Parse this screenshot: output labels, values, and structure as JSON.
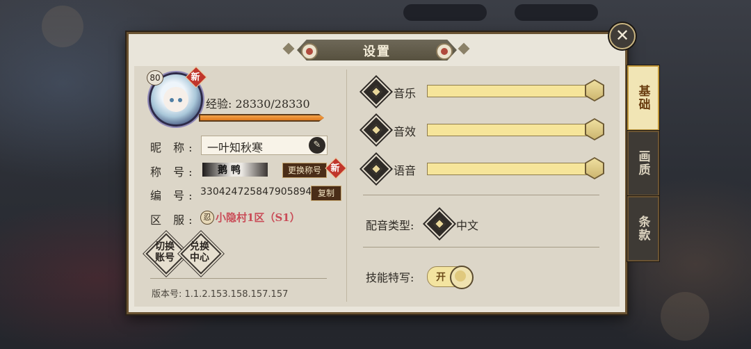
{
  "dialog": {
    "title": "设置",
    "close_symbol": "✕"
  },
  "tabs": [
    {
      "label": "基础",
      "active": true
    },
    {
      "label": "画质",
      "active": false
    },
    {
      "label": "条款",
      "active": false
    }
  ],
  "profile": {
    "level": "80",
    "new_badge": "新",
    "exp_label": "经验: 28330/28330",
    "exp_fraction": 1.0,
    "nickname_label": "昵 称:",
    "nickname_value": "一叶知秋寒",
    "title_label": "称 号:",
    "title_plate_text": "鹅 鸭",
    "change_title_button": "更换称号",
    "id_label": "编 号:",
    "id_value": "3304247258479058944",
    "copy_button": "复制",
    "server_label": "区 服:",
    "server_icon_glyph": "忍",
    "server_value": "小隐村1区（S1）",
    "switch_account_button": "切换\n账号",
    "redeem_center_button": "兑换\n中心",
    "version": "版本号: 1.1.2.153.158.157.157"
  },
  "audio": [
    {
      "label": "音乐",
      "level": 1.0
    },
    {
      "label": "音效",
      "level": 1.0
    },
    {
      "label": "语音",
      "level": 1.0
    }
  ],
  "voice_type": {
    "label": "配音类型:",
    "value": "中文"
  },
  "skill_closeup": {
    "label": "技能特写:",
    "state_text": "开",
    "on": true
  },
  "colors": {
    "accent_gold": "#f3e4a0",
    "badge_red": "#c0362c",
    "server_pink": "#c94b57"
  }
}
